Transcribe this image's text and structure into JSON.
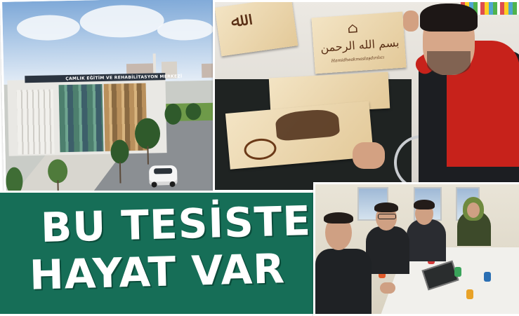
{
  "banner": {
    "line1": "BU TESİSTE",
    "line2": "HAYAT VAR",
    "background_color": "#166e57",
    "text_color": "#ffffff"
  },
  "photos": {
    "building": {
      "sign_text": "ÇAMLIK EĞİTİM VE REHABİLİTASYON MERKEZİ"
    },
    "pyrography": {
      "signature_text": "Hamidheakmaslaşdırılıcı"
    },
    "workshop": {}
  }
}
